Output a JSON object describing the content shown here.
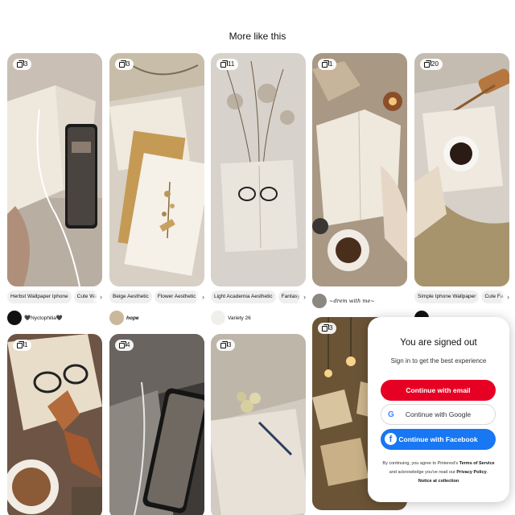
{
  "section_title": "More like this",
  "pins": [
    {
      "col": 0,
      "count": "3",
      "tags": [
        "Herbst Wallpaper Iphone",
        "Cute Wallp"
      ],
      "author": "🖤Nyctophilia🖤"
    },
    {
      "col": 1,
      "count": "3",
      "tags": [
        "Beige Aesthetic",
        "Flower Aesthetic"
      ],
      "author": "hope"
    },
    {
      "col": 2,
      "count": "11",
      "tags": [
        "Light Academia Aesthetic",
        "Fantasy A"
      ],
      "author": "Variety 26"
    },
    {
      "col": 3,
      "count": "1",
      "tags": [],
      "author": "~drem with me~"
    },
    {
      "col": 4,
      "count": "20",
      "tags": [
        "Simple Iphone Wallpaper",
        "Cute Fall W"
      ],
      "author": ""
    }
  ],
  "pins_row2": [
    {
      "col": 0,
      "count": "1"
    },
    {
      "col": 1,
      "count": "4"
    },
    {
      "col": 2,
      "count": "3"
    },
    {
      "col": 3,
      "count": "3"
    }
  ],
  "modal": {
    "title": "You are signed out",
    "subtitle": "Sign in to get the best experience",
    "email_button": "Continue with email",
    "google_button": "Continue with Google",
    "facebook_button": "Continue with Facebook",
    "legal_prefix": "By continuing, you agree to Pinterest's",
    "terms": "Terms of Service",
    "legal_mid": "and acknowledge you've read our",
    "privacy": "Privacy Policy",
    "notice": "Notice at collection"
  },
  "colors": {
    "brand_red": "#e60023",
    "facebook_blue": "#1877f2"
  }
}
